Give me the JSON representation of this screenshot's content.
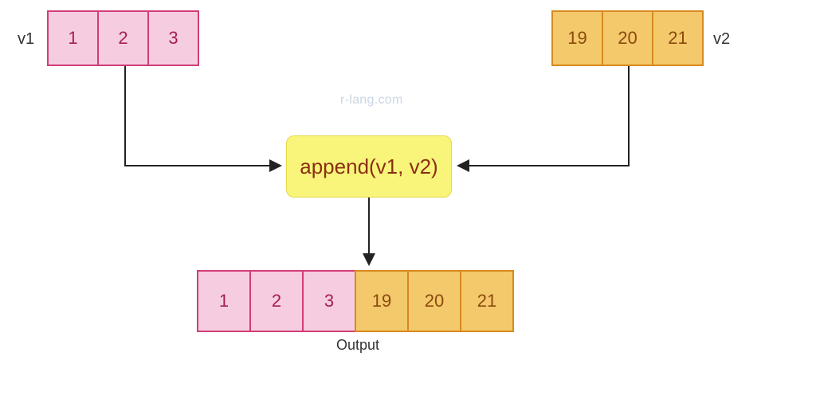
{
  "v1": {
    "label": "v1",
    "values": [
      "1",
      "2",
      "3"
    ]
  },
  "v2": {
    "label": "v2",
    "values": [
      "19",
      "20",
      "21"
    ]
  },
  "watermark": "r-lang.com",
  "function_call": "append(v1, v2)",
  "output": {
    "label": "Output",
    "values_left": [
      "1",
      "2",
      "3"
    ],
    "values_right": [
      "19",
      "20",
      "21"
    ]
  },
  "colors": {
    "pink_fill": "#f6cde0",
    "pink_border": "#d13d78",
    "pink_text": "#a41e53",
    "orange_fill": "#f3c96b",
    "orange_border": "#d78a1f",
    "orange_text": "#8b4a0d",
    "yellow_fill": "#f8f57a",
    "yellow_text": "#8b2e13"
  }
}
